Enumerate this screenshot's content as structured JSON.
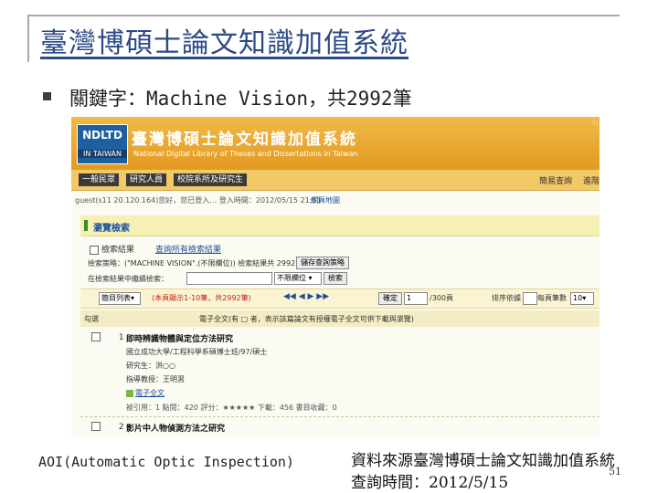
{
  "slide": {
    "title": "臺灣博碩士論文知識加值系統",
    "bullet": "關鍵字：Machine Vision，共2992筆",
    "footer_left": "AOI(Automatic Optic Inspection)",
    "footer_source": "資料來源臺灣博碩士論文知識加值系統",
    "footer_time": "查詢時間：2012/5/15",
    "page_number": "51"
  },
  "screenshot": {
    "logo_top": "NDLTD",
    "logo_bottom": "IN TAIWAN",
    "site_title": "臺灣博碩士論文知識加值系統",
    "site_subtitle": "National Digital Library of Theses and Dissertations in Taiwan",
    "corner": "::: ",
    "nav": {
      "tabs": [
        "一般民眾",
        "研究人員",
        "校院系所及研究生"
      ],
      "right_links": [
        "簡易查詢",
        "進階"
      ]
    },
    "session_text": "guest(s11 20.120.164)您好，您已登入…  登入時間：2012/05/15 21:51",
    "session_link": "網頁地圖",
    "panel_title": "瀏覽檢索",
    "search_results_label": "檢索結果",
    "history_link": "查詢所有檢索結果",
    "query_desc": "檢索策略：(\"MACHINE VISION\".(不限欄位)) 檢索結果共 2992 筆資料",
    "query_link": "儲存查詢策略",
    "query_prefix": "在檢索結果中繼續檢索：",
    "field_select": "不限欄位",
    "search_btn": "檢索",
    "save_btn": "確定",
    "toolbar": {
      "format_select": "簡目列表",
      "result_info": "(本頁顯示1-10筆，共2992筆)",
      "nav_arrows": "◀◀  ◀  ▶  ▶▶",
      "page_input": "1",
      "go_btn": "確定",
      "page_total": "/300頁",
      "sort_label": "排序依據",
      "per_page_label": "每頁筆數",
      "per_page_select": "10"
    },
    "list_head": {
      "col1": "勾選",
      "note": "電子全文(有  □  者，表示該篇論文有授權電子全文可供下載與瀏覽)"
    },
    "records": [
      {
        "index": "1",
        "title": "即時辨識物體與定位方法研究",
        "dept": "國立成功大學/工程科學系碩博士班/97/碩士",
        "student": "研究生：洪○○",
        "advisor": "指導教授：王明習",
        "fulltext": "電子全文",
        "stats": "被引用：1   點閱：420   評分：★★★★★   下載：456   書目收藏：0"
      },
      {
        "index": "2",
        "title": "影片中人物偵測方法之研究"
      }
    ]
  }
}
